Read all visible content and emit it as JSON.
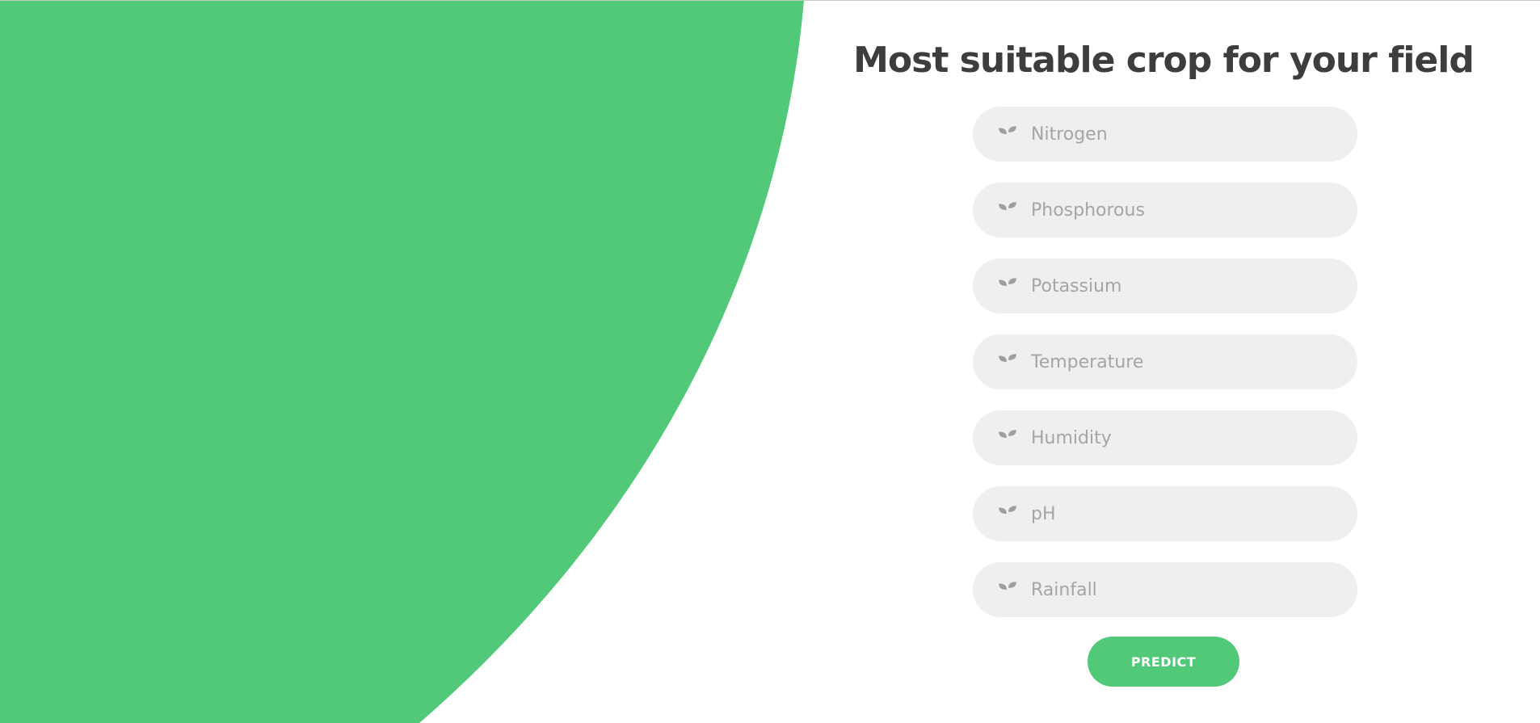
{
  "title": "Most suitable crop for your field",
  "form": {
    "fields": [
      {
        "placeholder": "Nitrogen",
        "value": ""
      },
      {
        "placeholder": "Phosphorous",
        "value": ""
      },
      {
        "placeholder": "Potassium",
        "value": ""
      },
      {
        "placeholder": "Temperature",
        "value": ""
      },
      {
        "placeholder": "Humidity",
        "value": ""
      },
      {
        "placeholder": "pH",
        "value": ""
      },
      {
        "placeholder": "Rainfall",
        "value": ""
      }
    ],
    "field_icon": "sprout-icon",
    "submit_label": "PREDICT"
  },
  "colors": {
    "accent": "#52c979",
    "title": "#3d3d3d",
    "field_bg": "#efefef",
    "placeholder": "#a5a5a5",
    "icon": "#9e9e9e"
  }
}
